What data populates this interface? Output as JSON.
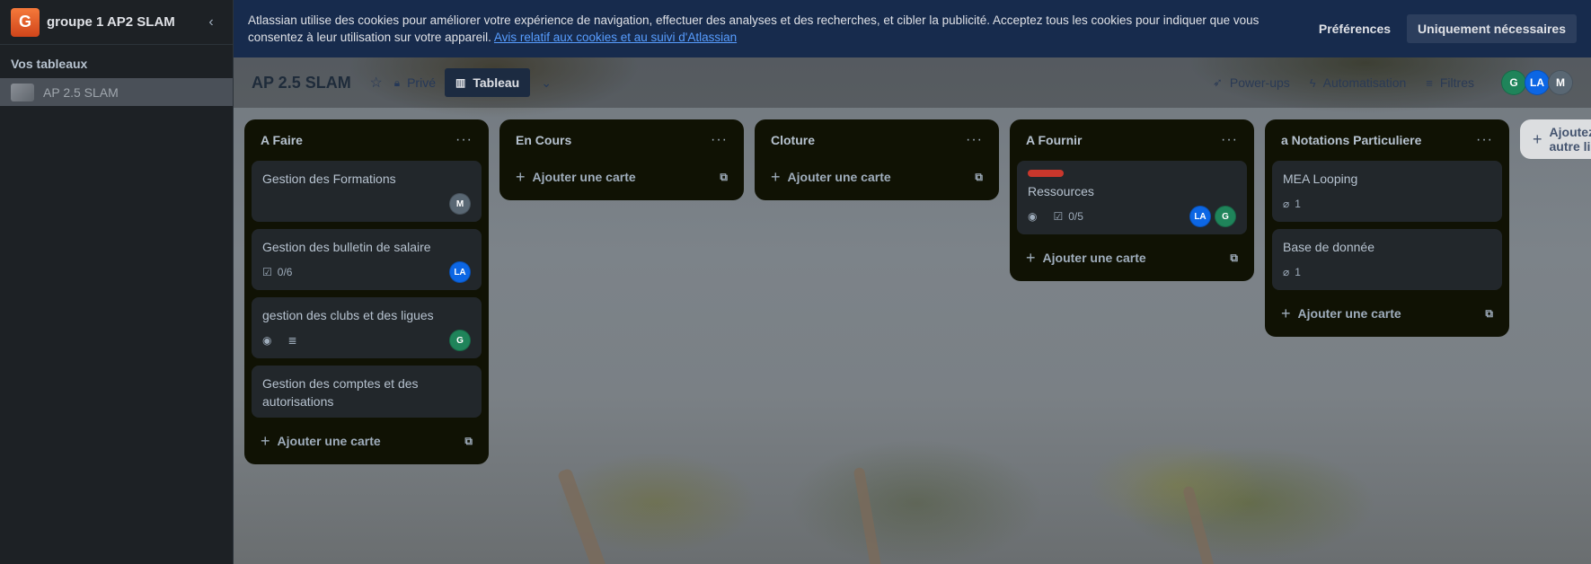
{
  "workspace": {
    "logo_letter": "G",
    "name": "groupe 1 AP2 SLAM",
    "collapse_icon": "chevron-left-icon"
  },
  "sidebar": {
    "section_title": "Vos tableaux",
    "boards": [
      {
        "label": "AP 2.5 SLAM"
      }
    ]
  },
  "cookie_banner": {
    "text": "Atlassian utilise des cookies pour améliorer votre expérience de navigation, effectuer des analyses et des recherches, et cibler la publicité. Acceptez tous les cookies pour indiquer que vous consentez à leur utilisation sur votre appareil.",
    "link": "Avis relatif aux cookies et au suivi d'Atlassian",
    "preferences": "Préférences",
    "necessary_only": "Uniquement nécessaires"
  },
  "board_header": {
    "title": "AP 2.5 SLAM",
    "visibility": "Privé",
    "view": "Tableau",
    "powerups": "Power-ups",
    "automation": "Automatisation",
    "filters": "Filtres",
    "members": [
      "G",
      "LA",
      "M"
    ]
  },
  "lists": [
    {
      "title": "A Faire",
      "cards": [
        {
          "title": "Gestion des Formations",
          "members": [
            "M"
          ]
        },
        {
          "title": "Gestion des bulletin de salaire",
          "checklist": "0/6",
          "members": [
            "LA"
          ]
        },
        {
          "title": "gestion des clubs et des ligues",
          "members": [
            "G"
          ]
        },
        {
          "title": "Gestion des comptes et des autorisations"
        }
      ],
      "add_label": "Ajouter une carte"
    },
    {
      "title": "En Cours",
      "cards": [],
      "add_label": "Ajouter une carte"
    },
    {
      "title": "Cloture",
      "cards": [],
      "add_label": "Ajouter une carte"
    },
    {
      "title": "A Fournir",
      "cards": [
        {
          "title": "Ressources",
          "label_color": "#c9372c",
          "checklist": "0/5",
          "members": [
            "LA",
            "G"
          ]
        }
      ],
      "add_label": "Ajouter une carte"
    },
    {
      "title": "a Notations Particuliere",
      "cards": [
        {
          "title": "MEA Looping",
          "attachments": "1"
        },
        {
          "title": "Base de donnée",
          "attachments": "1"
        }
      ],
      "add_label": "Ajouter une carte"
    }
  ],
  "add_list_label": "Ajoutez une autre liste",
  "colors": {
    "banner_bg": "#172b4d",
    "list_bg": "#101204",
    "card_bg": "#22272b",
    "accent_blue": "#579dff"
  }
}
